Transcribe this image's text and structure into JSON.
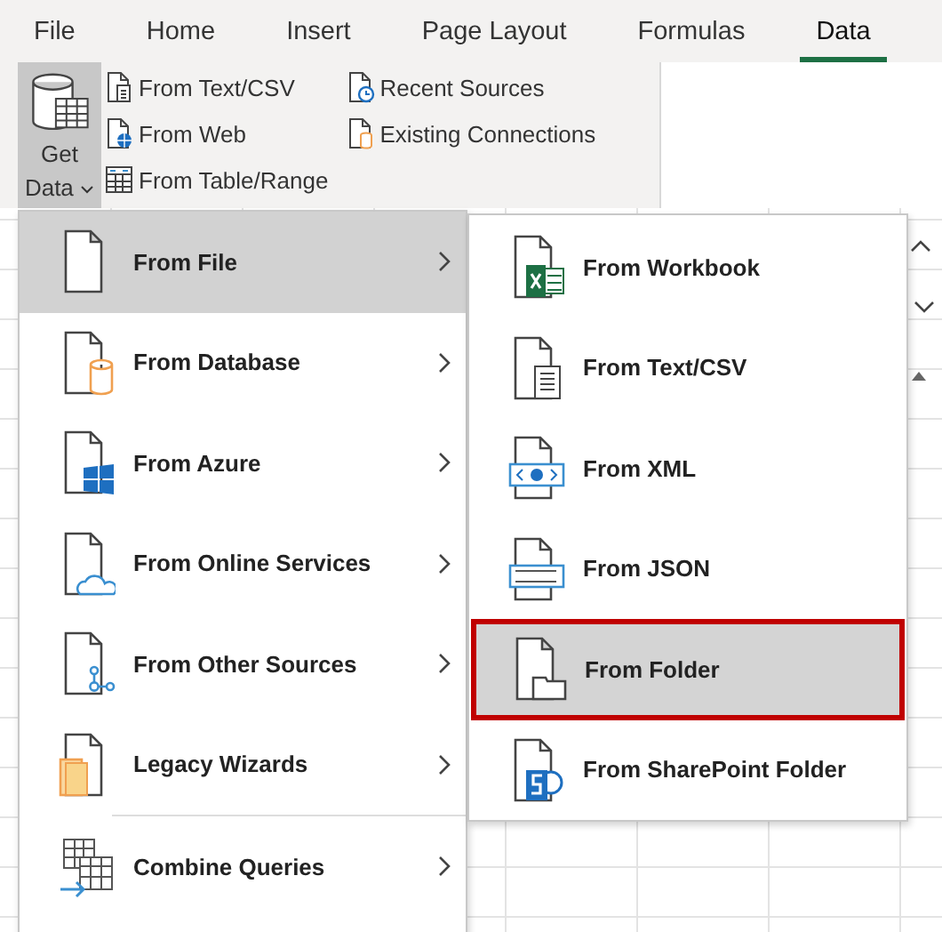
{
  "tabs": [
    {
      "label": "File",
      "selected": false
    },
    {
      "label": "Home",
      "selected": false
    },
    {
      "label": "Insert",
      "selected": false
    },
    {
      "label": "Page Layout",
      "selected": false
    },
    {
      "label": "Formulas",
      "selected": false
    },
    {
      "label": "Data",
      "selected": true
    }
  ],
  "ribbon": {
    "get_data": {
      "label": "Get Data",
      "selected": true
    },
    "commands": [
      {
        "label": "From Text/CSV"
      },
      {
        "label": "From Web"
      },
      {
        "label": "From Table/Range"
      },
      {
        "label": "Recent Sources"
      },
      {
        "label": "Existing Connections"
      }
    ]
  },
  "menu": {
    "items": [
      {
        "label": "From File",
        "selected": true,
        "has_submenu": true
      },
      {
        "label": "From Database",
        "selected": false,
        "has_submenu": true
      },
      {
        "label": "From Azure",
        "selected": false,
        "has_submenu": true
      },
      {
        "label": "From Online Services",
        "selected": false,
        "has_submenu": true
      },
      {
        "label": "From Other Sources",
        "selected": false,
        "has_submenu": true
      },
      {
        "label": "Legacy Wizards",
        "selected": false,
        "has_submenu": true
      },
      {
        "label": "Combine Queries",
        "selected": false,
        "has_submenu": true
      }
    ]
  },
  "submenu": {
    "items": [
      {
        "label": "From Workbook",
        "selected": false
      },
      {
        "label": "From Text/CSV",
        "selected": false
      },
      {
        "label": "From XML",
        "selected": false
      },
      {
        "label": "From JSON",
        "selected": false
      },
      {
        "label": "From Folder",
        "selected": true
      },
      {
        "label": "From SharePoint Folder",
        "selected": false
      }
    ]
  }
}
